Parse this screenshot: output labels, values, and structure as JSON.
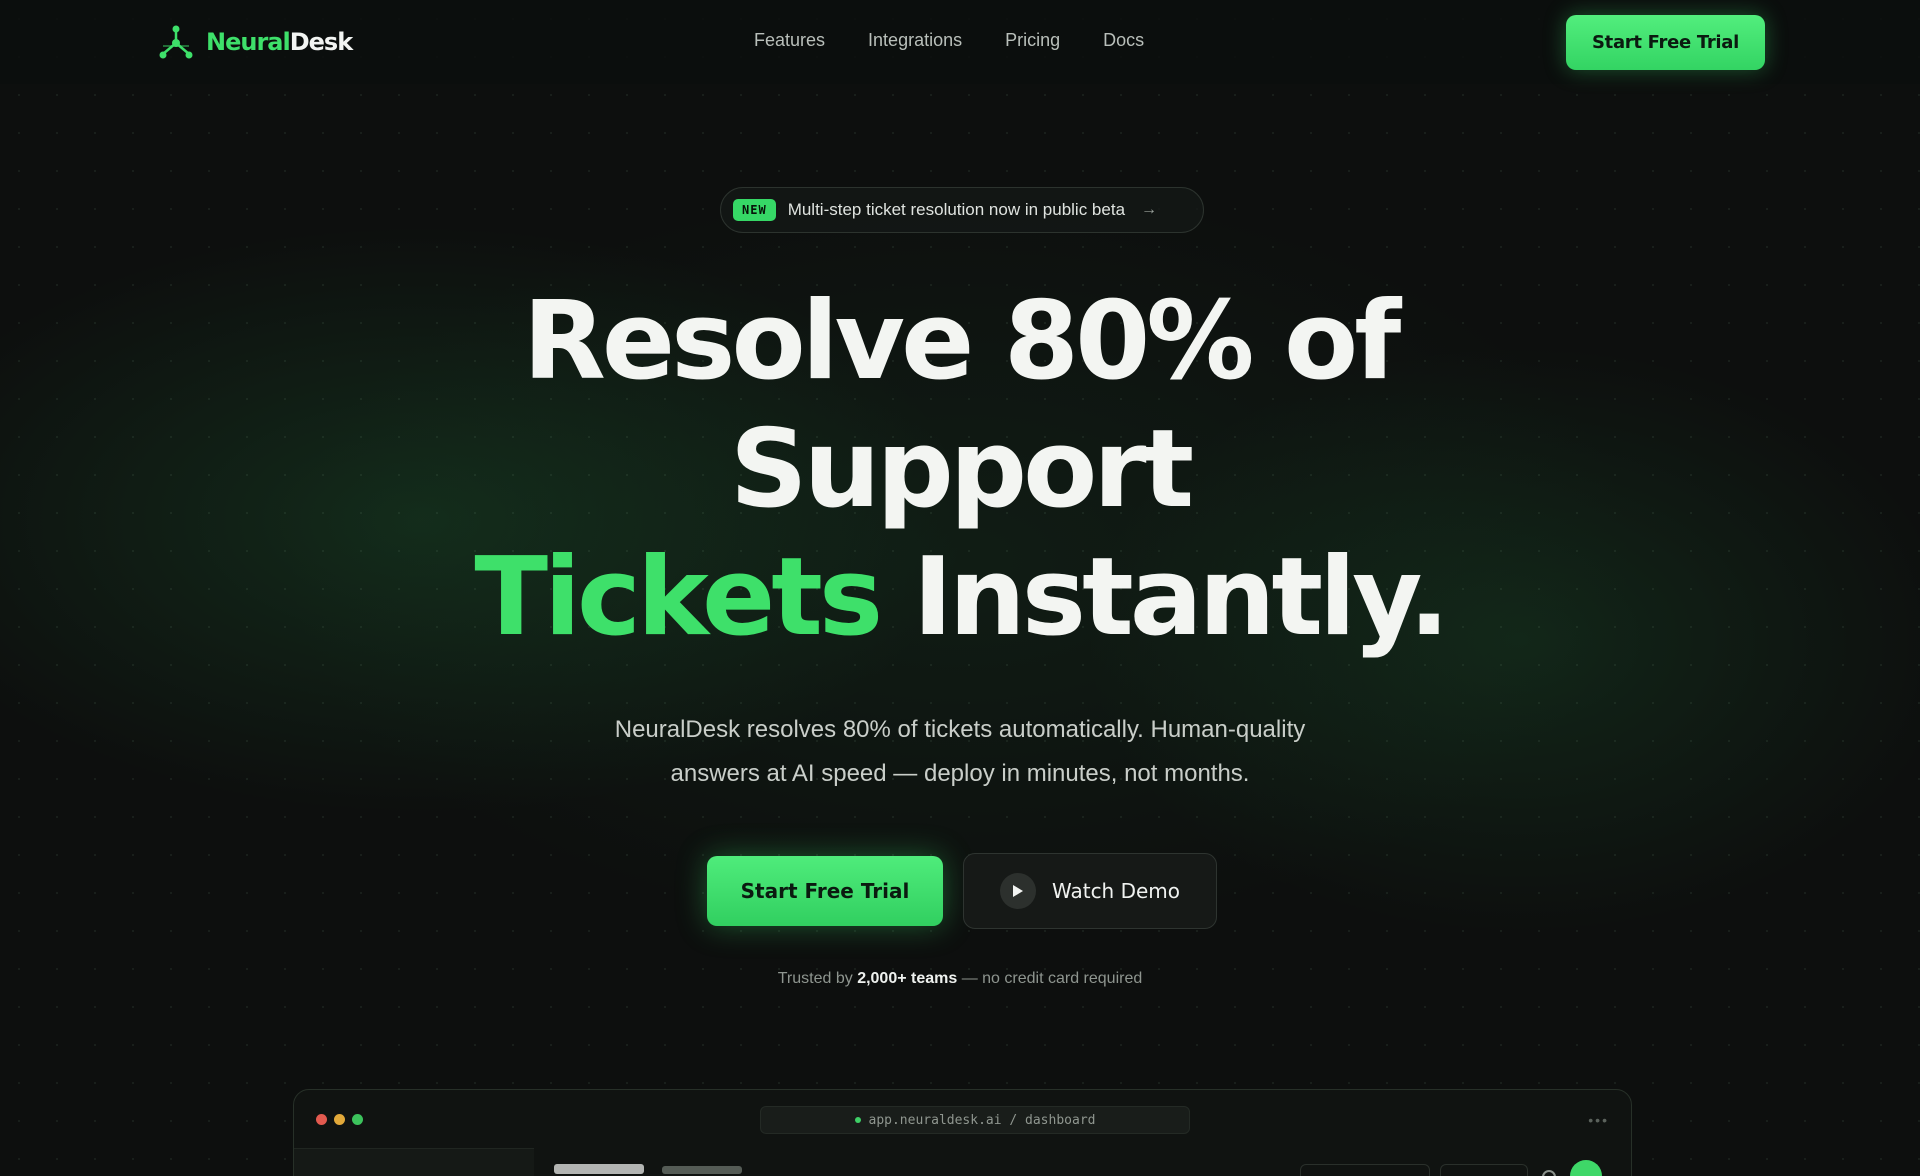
{
  "brand": {
    "name_part1": "Neural",
    "name_part2": "Desk"
  },
  "nav": {
    "links": [
      "Features",
      "Integrations",
      "Pricing",
      "Docs"
    ],
    "cta": "Start Free Trial"
  },
  "badge": {
    "tag": "NEW",
    "text": "Multi-step ticket resolution now in public beta",
    "arrow": "→"
  },
  "hero": {
    "line1": "Resolve 80% of",
    "line2": "Support",
    "line3_accent": "Tickets",
    "line3_rest": " Instantly.",
    "subtitle_line1": "NeuralDesk resolves 80% of tickets automatically. Human-quality",
    "subtitle_line2": "answers at AI speed — deploy in minutes, not months.",
    "primary_cta": "Start Free Trial",
    "secondary_cta": "Watch Demo",
    "trusted_prefix": "Trusted by ",
    "trusted_bold": "2,000+ teams",
    "trusted_suffix": " — no credit card required"
  },
  "preview": {
    "url": "app.neuraldesk.ai / dashboard",
    "menu": "•••"
  },
  "colors": {
    "accent": "#3ee06a",
    "background": "#0d0f0e"
  },
  "icons": [
    "logo-network-icon",
    "arrow-right-icon",
    "play-icon"
  ]
}
